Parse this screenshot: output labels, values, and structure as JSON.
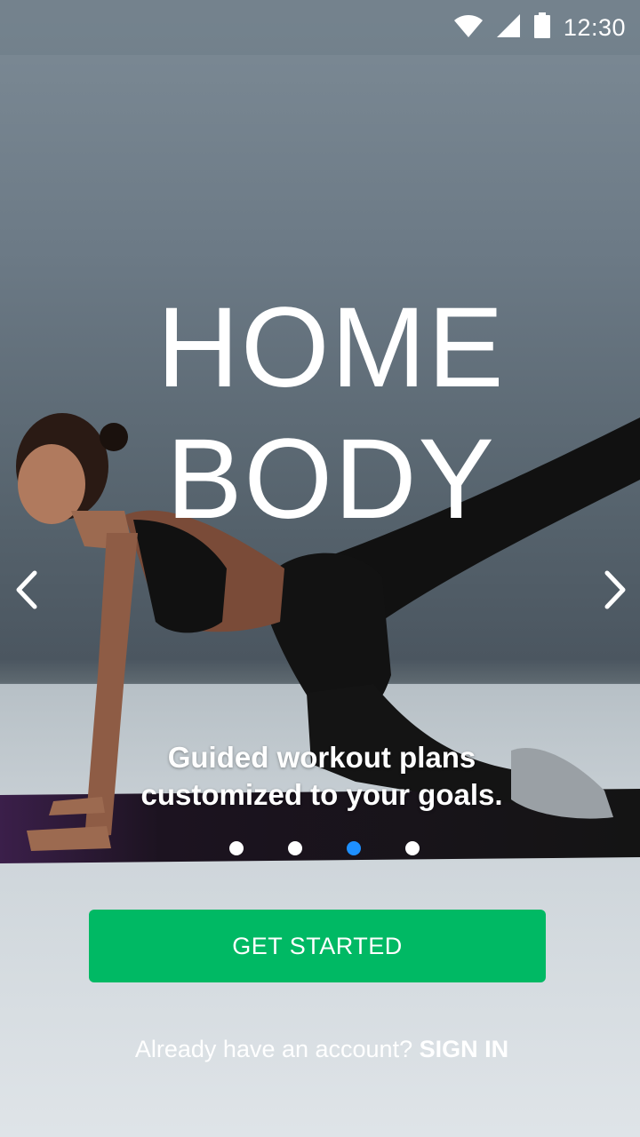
{
  "status_bar": {
    "time": "12:30",
    "icons": [
      "wifi-icon",
      "signal-icon",
      "battery-icon"
    ]
  },
  "hero": {
    "title_line1": "HOME",
    "title_line2": "BODY",
    "tagline_line1": "Guided workout plans",
    "tagline_line2": "customized to your goals."
  },
  "carousel": {
    "prev_icon": "chevron-left-icon",
    "next_icon": "chevron-right-icon",
    "page_count": 4,
    "active_index": 2
  },
  "actions": {
    "get_started_label": "GET STARTED",
    "signin_prompt": "Already have an account?",
    "signin_label": "SIGN IN"
  },
  "colors": {
    "accent": "#00b964",
    "active_dot": "#1e90ff"
  }
}
